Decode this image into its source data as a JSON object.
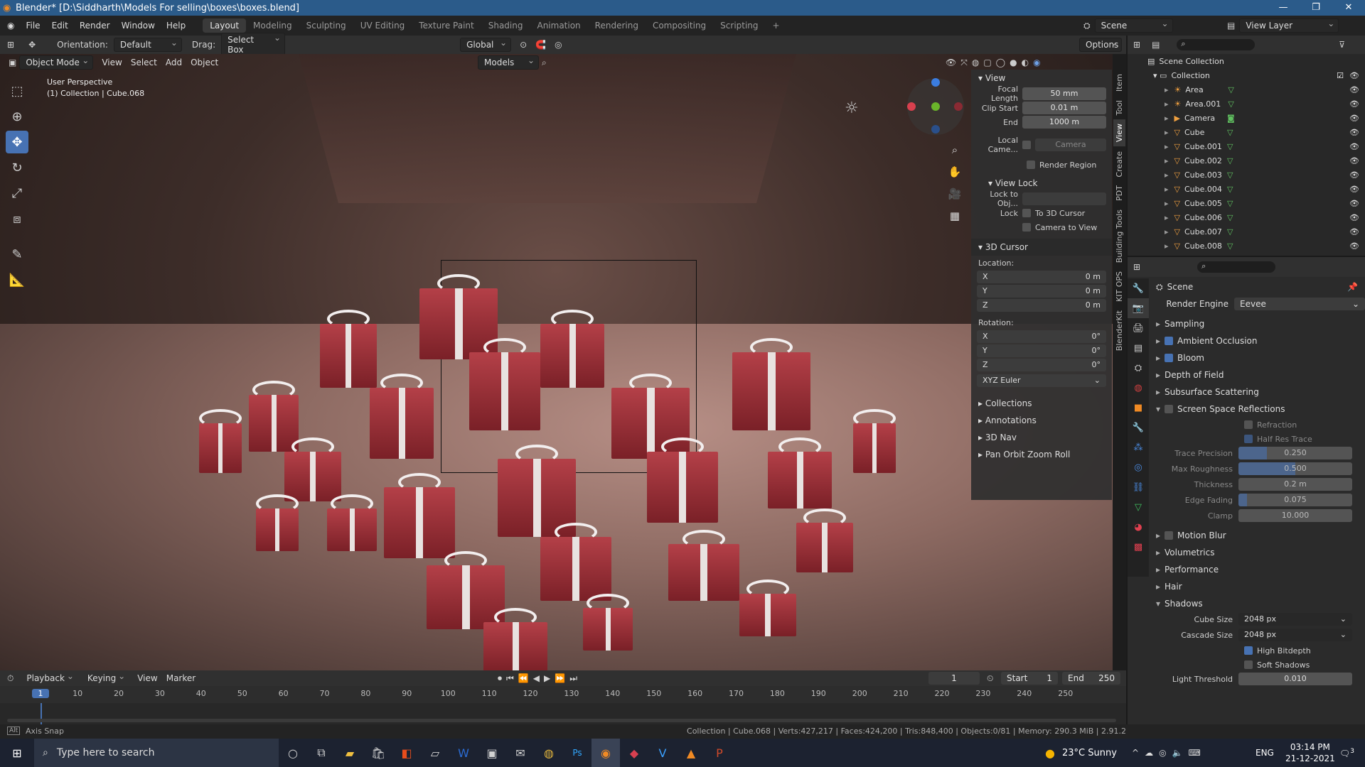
{
  "window": {
    "title": "Blender* [D:\\Siddharth\\Models For selling\\boxes\\boxes.blend]",
    "minimize": "—",
    "maximize": "❐",
    "close": "✕"
  },
  "menu": [
    "File",
    "Edit",
    "Render",
    "Window",
    "Help"
  ],
  "workspaces": [
    "Layout",
    "Modeling",
    "Sculpting",
    "UV Editing",
    "Texture Paint",
    "Shading",
    "Animation",
    "Rendering",
    "Compositing",
    "Scripting",
    "+"
  ],
  "scene": {
    "label": "Scene",
    "view_layer": "View Layer"
  },
  "toolheader": {
    "orientation_label": "Orientation:",
    "orientation": "Default",
    "drag_label": "Drag:",
    "drag": "Select Box",
    "transform": "Global",
    "options": "Options",
    "models": "Models"
  },
  "vp_header": {
    "mode": "Object Mode",
    "view": "View",
    "select": "Select",
    "add": "Add",
    "object": "Object"
  },
  "overlay": {
    "line1": "User Perspective",
    "line2": "(1) Collection | Cube.068"
  },
  "tools": [
    {
      "icon": "select-box",
      "g": "⬚",
      "active": false
    },
    {
      "icon": "cursor",
      "g": "⊕",
      "active": false
    },
    {
      "icon": "move",
      "g": "✥",
      "active": true
    },
    {
      "icon": "rotate",
      "g": "↻",
      "active": false
    },
    {
      "icon": "scale",
      "g": "⤢",
      "active": false
    },
    {
      "icon": "transform",
      "g": "⧈",
      "active": false
    },
    {
      "icon": "annotate",
      "g": "✎",
      "active": false
    },
    {
      "icon": "measure",
      "g": "📐",
      "active": false
    }
  ],
  "npanel": {
    "view": "View",
    "focal_length_label": "Focal Length",
    "focal_length": "50 mm",
    "clip_start_label": "Clip Start",
    "clip_start": "0.01 m",
    "end_label": "End",
    "end": "1000 m",
    "local_camera_label": "Local Came...",
    "local_camera": "Camera",
    "render_region": "Render Region",
    "view_lock": "View Lock",
    "lock_to_obj": "Lock to Obj...",
    "lock": "Lock",
    "to_3d_cursor": "To 3D Cursor",
    "camera_to_view": "Camera to View",
    "cursor": "3D Cursor",
    "location": "Location:",
    "rotation": "Rotation:",
    "loc": [
      {
        "axis": "X",
        "value": "0 m"
      },
      {
        "axis": "Y",
        "value": "0 m"
      },
      {
        "axis": "Z",
        "value": "0 m"
      }
    ],
    "rot": [
      {
        "axis": "X",
        "value": "0°"
      },
      {
        "axis": "Y",
        "value": "0°"
      },
      {
        "axis": "Z",
        "value": "0°"
      }
    ],
    "rot_mode": "XYZ Euler",
    "collections": "Collections",
    "annotations": "Annotations",
    "nav3d": "3D Nav",
    "pan_orbit": "Pan Orbit Zoom Roll"
  },
  "vtabs": [
    "Item",
    "Tool",
    "View",
    "Create",
    "PDT",
    "Building Tools",
    "KIT OPS",
    "BlenderKit"
  ],
  "outliner": {
    "root": "Scene Collection",
    "collection": "Collection",
    "items": [
      "Area",
      "Area.001",
      "Camera",
      "Cube",
      "Cube.001",
      "Cube.002",
      "Cube.003",
      "Cube.004",
      "Cube.005",
      "Cube.006",
      "Cube.007",
      "Cube.008"
    ]
  },
  "props": {
    "scene": "Scene",
    "render_engine_label": "Render Engine",
    "render_engine": "Eevee",
    "sections": [
      {
        "label": "Sampling",
        "check": null
      },
      {
        "label": "Ambient Occlusion",
        "check": true
      },
      {
        "label": "Bloom",
        "check": true
      },
      {
        "label": "Depth of Field",
        "check": null
      },
      {
        "label": "Subsurface Scattering",
        "check": null
      },
      {
        "label": "Screen Space Reflections",
        "check": false
      }
    ],
    "ssr": {
      "refraction": "Refraction",
      "half_res": "Half Res Trace",
      "fields": [
        {
          "label": "Trace Precision",
          "value": "0.250",
          "fill": 0.25
        },
        {
          "label": "Max Roughness",
          "value": "0.500",
          "fill": 0.5
        },
        {
          "label": "Thickness",
          "value": "0.2 m",
          "fill": 0
        },
        {
          "label": "Edge Fading",
          "value": "0.075",
          "fill": 0.075
        },
        {
          "label": "Clamp",
          "value": "10.000",
          "fill": 0
        }
      ]
    },
    "sections2": [
      {
        "label": "Motion Blur",
        "check": false
      },
      {
        "label": "Volumetrics",
        "check": null
      },
      {
        "label": "Performance",
        "check": null
      },
      {
        "label": "Hair",
        "check": null
      },
      {
        "label": "Shadows",
        "check": null
      }
    ],
    "shadows": {
      "cube_size_label": "Cube Size",
      "cube_size": "2048 px",
      "cascade_size_label": "Cascade Size",
      "cascade_size": "2048 px",
      "high_bitdepth": "High Bitdepth",
      "soft_shadows": "Soft Shadows",
      "light_threshold_label": "Light Threshold",
      "light_threshold": "0.010"
    }
  },
  "timeline": {
    "playback": "Playback",
    "keying": "Keying",
    "view": "View",
    "marker": "Marker",
    "current": "1",
    "start_label": "Start",
    "start": "1",
    "end_label": "End",
    "end": "250",
    "ticks": [
      "1",
      "10",
      "20",
      "30",
      "40",
      "50",
      "60",
      "70",
      "80",
      "90",
      "100",
      "110",
      "120",
      "130",
      "140",
      "150",
      "160",
      "170",
      "180",
      "190",
      "200",
      "210",
      "220",
      "230",
      "240",
      "250"
    ]
  },
  "status": {
    "left": "Axis Snap",
    "right": "Collection | Cube.068 | Verts:427,217 | Faces:424,200 | Tris:848,400 | Objects:0/81 | Memory: 290.3 MiB | 2.91.2"
  },
  "taskbar": {
    "search": "Type here to search",
    "weather": "23°C  Sunny",
    "lang": "ENG",
    "time": "03:14 PM",
    "date": "21-12-2021",
    "notif": "3"
  }
}
